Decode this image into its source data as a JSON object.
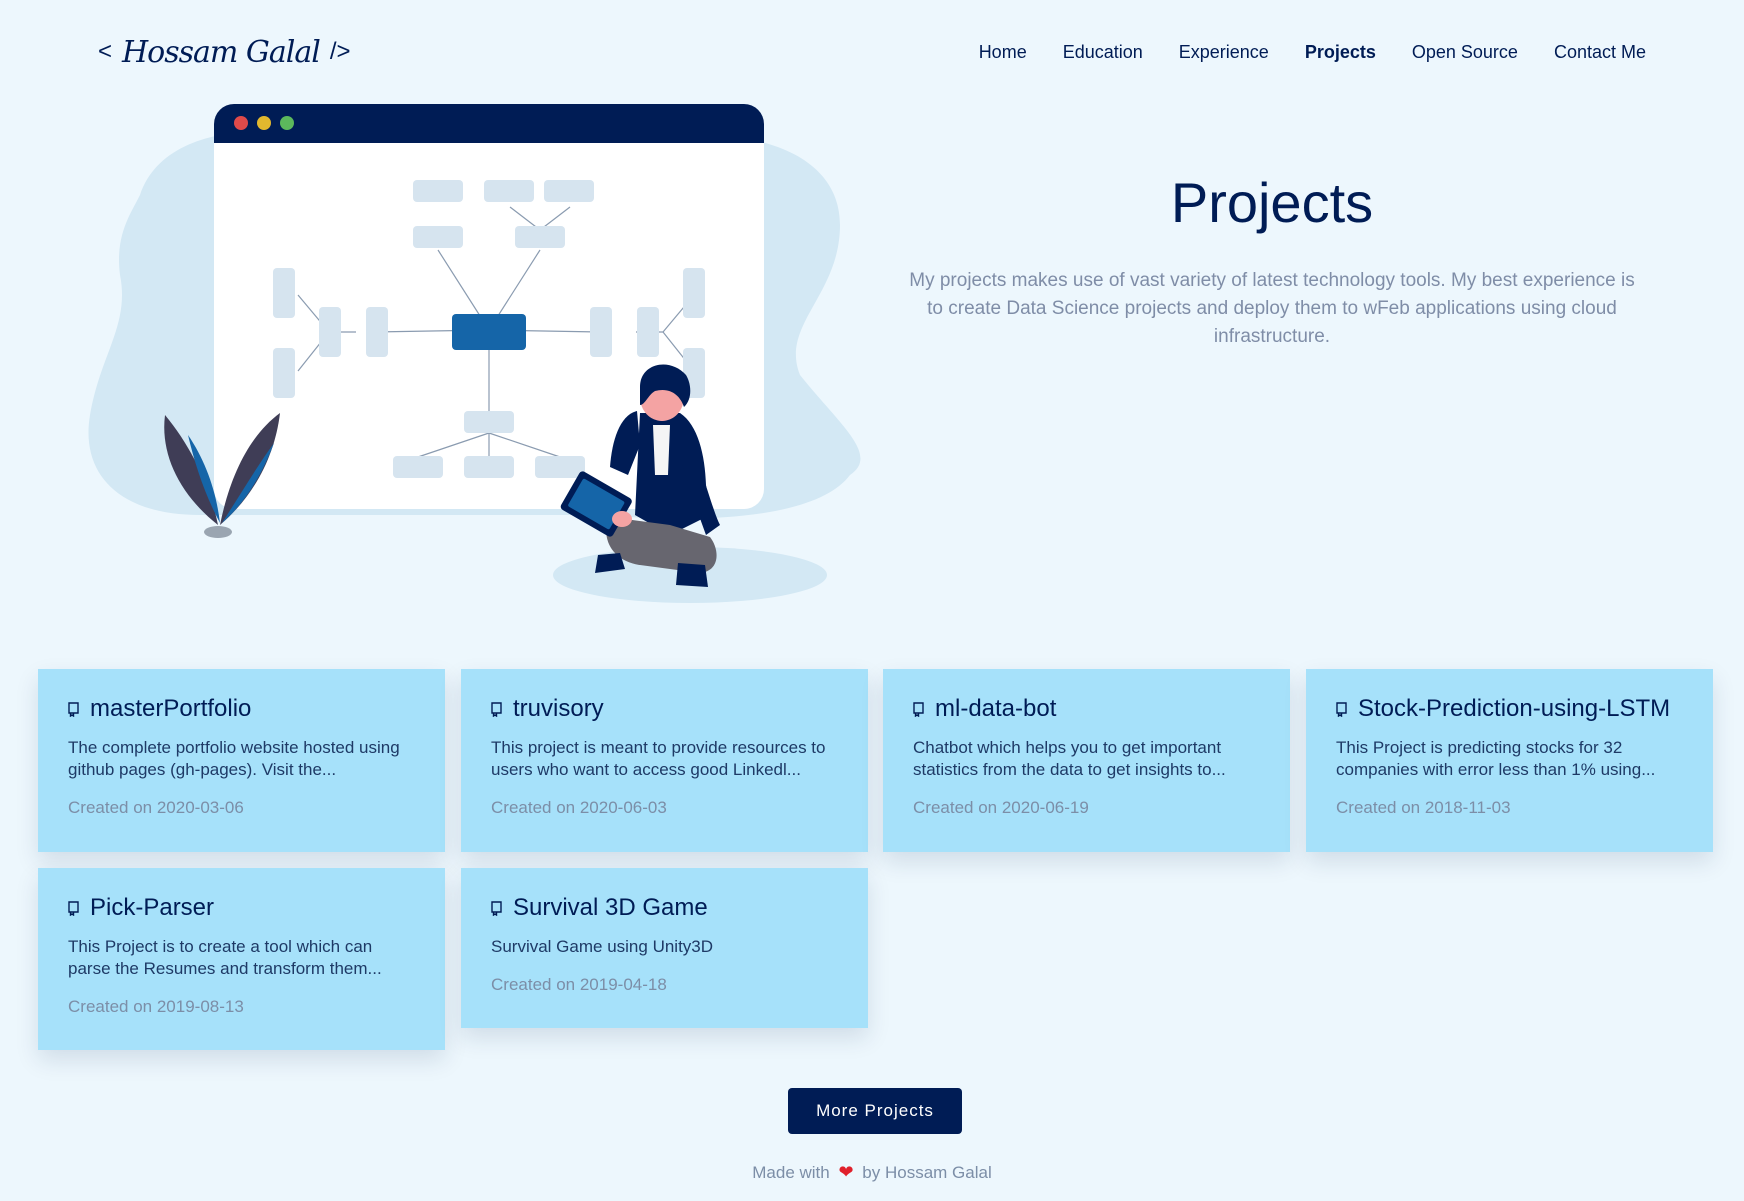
{
  "header": {
    "logo_left": "<",
    "logo_signature": "Hossam Galal",
    "logo_right": "/>",
    "nav": [
      {
        "label": "Home"
      },
      {
        "label": "Education"
      },
      {
        "label": "Experience"
      },
      {
        "label": "Projects",
        "active": true
      },
      {
        "label": "Open Source"
      },
      {
        "label": "Contact Me"
      }
    ]
  },
  "hero": {
    "title": "Projects",
    "description": "My projects makes use of vast variety of latest technology tools. My best experience is to create Data Science projects and deploy them to wFeb applications using cloud infrastructure."
  },
  "projects": [
    {
      "name": "masterPortfolio",
      "description": "The complete portfolio website hosted using github pages (gh-pages). Visit the...",
      "date": "Created on 2020-03-06"
    },
    {
      "name": "truvisory",
      "description": "This project is meant to provide resources to users who want to access good Linkedl...",
      "date": "Created on 2020-06-03"
    },
    {
      "name": "ml-data-bot",
      "description": "Chatbot which helps you to get important statistics from the data to get insights to...",
      "date": "Created on 2020-06-19"
    },
    {
      "name": "Stock-Prediction-using-LSTM",
      "description": "This Project is predicting stocks for 32 companies with error less than 1% using...",
      "date": "Created on 2018-11-03"
    },
    {
      "name": "Pick-Parser",
      "description": "This Project is to create a tool which can parse the Resumes and transform them...",
      "date": "Created on 2019-08-13"
    },
    {
      "name": "Survival 3D Game",
      "description": "Survival Game using Unity3D",
      "date": "Created on 2019-04-18"
    }
  ],
  "more_button": "More Projects",
  "footer": {
    "prefix": "Made with",
    "heart": "❤",
    "suffix": "by Hossam Galal"
  },
  "colors": {
    "background": "#edf7fd",
    "card": "#a6e1fa",
    "navy": "#001c55",
    "muted": "#7c8ea7",
    "heart": "#e0202b"
  }
}
